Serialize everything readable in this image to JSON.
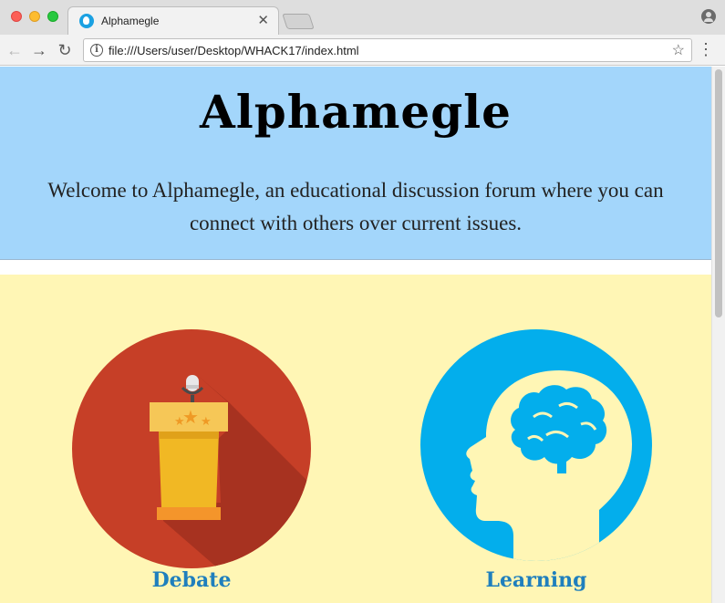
{
  "browser": {
    "tab_title": "Alphamegle",
    "url": "file:///Users/user/Desktop/WHACK17/index.html"
  },
  "header": {
    "title": "Alphamegle",
    "welcome": "Welcome to Alphamegle, an educational discussion forum where you can connect with others over current issues."
  },
  "topics": [
    {
      "label": "Debate",
      "icon": "podium-icon"
    },
    {
      "label": "Learning",
      "icon": "brain-head-icon"
    }
  ],
  "colors": {
    "hero_bg": "#a3d6fb",
    "topics_bg": "#fff6b5",
    "debate_circle": "#c63f27",
    "learning_circle": "#03aeec",
    "label_color": "#1f7fbd"
  }
}
